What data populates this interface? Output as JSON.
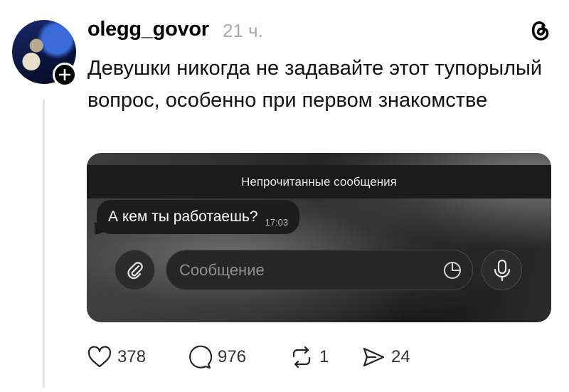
{
  "post": {
    "username": "olegg_govor",
    "time": "21 ч.",
    "text": "Девушки никогда не задавайте этот тупорылый вопрос, особенно при первом знакомстве"
  },
  "media": {
    "unread_label": "Непрочитанные сообщения",
    "message": "А кем ты работаешь?",
    "message_time": "17:03",
    "input_placeholder": "Сообщение"
  },
  "actions": {
    "likes": "378",
    "comments": "976",
    "reposts": "1",
    "shares": "24"
  },
  "icons": {
    "follow": "plus-icon",
    "app_logo": "threads-logo-icon",
    "attach": "paperclip-icon",
    "sticker": "sticker-icon",
    "mic": "microphone-icon",
    "like": "heart-icon",
    "comment": "comment-icon",
    "repost": "repost-icon",
    "share": "send-icon"
  }
}
